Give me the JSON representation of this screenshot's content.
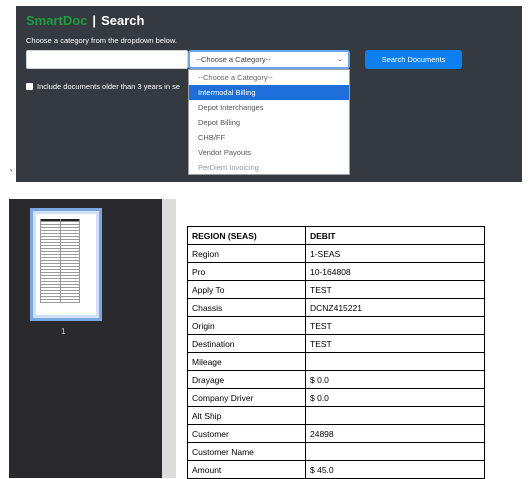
{
  "header": {
    "logo_text": "SmartDoc",
    "separator": "|",
    "page_title": "Search",
    "logo_color": "#1f9d3f",
    "background": "#343a40"
  },
  "search": {
    "instructions": "Choose a category from the dropdown below.",
    "text_value": "",
    "category_selected": "--Choose a Category--",
    "search_button_label": "Search Documents",
    "search_button_color": "#0d7ff0",
    "older_checkbox_label": "Include documents older than 3 years in se",
    "older_checkbox_checked": false
  },
  "dropdown": {
    "options": [
      "--Choose a Category--",
      "Intermodal Billing",
      "Depot Interchanges",
      "Depot Billing",
      "CHB/FF",
      "Vendor Payouts",
      "PerDiem Invoicing"
    ],
    "highlighted": "Intermodal Billing",
    "highlight_color": "#1e6fd9"
  },
  "stray_mark": "`",
  "viewer": {
    "thumbnail_page_number": "1",
    "selected_page": 1
  },
  "document_table": {
    "header": [
      "REGION (SEAS)",
      "DEBIT"
    ],
    "rows": [
      [
        "Region",
        "1-SEAS"
      ],
      [
        "Pro",
        "10-164808"
      ],
      [
        "Apply To",
        "TEST"
      ],
      [
        "Chassis",
        "DCNZ415221"
      ],
      [
        "Origin",
        "TEST"
      ],
      [
        "Destination",
        "TEST"
      ],
      [
        "Mileage",
        ""
      ],
      [
        "Drayage",
        "$ 0.0"
      ],
      [
        "Company Driver",
        "$ 0.0"
      ],
      [
        "Alt Ship",
        ""
      ],
      [
        "Customer",
        "24898"
      ],
      [
        "Customer Name",
        ""
      ],
      [
        "Amount",
        "$ 45.0"
      ]
    ]
  }
}
